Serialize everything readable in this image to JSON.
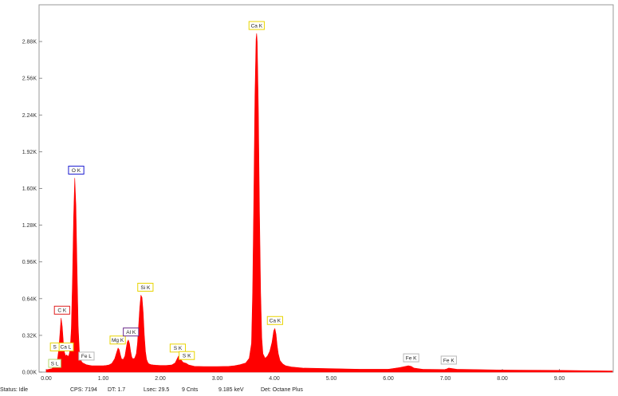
{
  "colors": {
    "spectrum": "#ff0000",
    "label_red": "#e02020",
    "label_blue": "#1c1cd0",
    "label_yellow": "#e8d400",
    "label_purple": "#6a2a8a",
    "label_gray": "#b8b8b8",
    "label_green": "#b8d870"
  },
  "status": {
    "status": "Status: Idle",
    "cps": "CPS: 7194",
    "dt": "DT: 1.7",
    "lsec": "Lsec: 29.5",
    "cnts": "9 Cnts",
    "kev": "9.185 keV",
    "det": "Det: Octane Plus"
  },
  "chart_data": {
    "type": "area",
    "title": "",
    "xlabel": "",
    "ylabel": "",
    "xlim": [
      0,
      10
    ],
    "ylim": [
      0,
      3200
    ],
    "grid": false,
    "legend": "none",
    "x_ticks": [
      0,
      1,
      2,
      3,
      4,
      5,
      6,
      7,
      8,
      9
    ],
    "x_tick_labels": [
      "0.00",
      "1.00",
      "2.00",
      "3.00",
      "4.00",
      "5.00",
      "6.00",
      "7.00",
      "8.00",
      "9.00"
    ],
    "y_ticks": [
      0,
      320,
      640,
      960,
      1280,
      1600,
      1920,
      2240,
      2560,
      2880
    ],
    "y_tick_labels": [
      "0.00K",
      "0.32K",
      "0.64K",
      "0.96K",
      "1.28K",
      "1.60K",
      "1.92K",
      "2.24K",
      "2.56K",
      "2.88K"
    ],
    "series": [
      {
        "x": [
          0.0,
          0.1,
          0.15,
          0.2,
          0.22,
          0.24,
          0.26,
          0.28,
          0.3,
          0.32,
          0.34,
          0.36,
          0.38,
          0.4,
          0.42,
          0.44,
          0.46,
          0.48,
          0.5,
          0.52,
          0.54,
          0.56,
          0.58,
          0.6,
          0.62,
          0.64,
          0.66,
          0.68,
          0.7,
          0.75,
          0.8,
          0.85,
          0.9,
          0.95,
          1.0,
          1.05,
          1.1,
          1.15,
          1.2,
          1.24,
          1.26,
          1.28,
          1.3,
          1.32,
          1.35,
          1.38,
          1.4,
          1.42,
          1.44,
          1.46,
          1.48,
          1.5,
          1.52,
          1.55,
          1.58,
          1.6,
          1.62,
          1.64,
          1.66,
          1.68,
          1.7,
          1.72,
          1.74,
          1.76,
          1.78,
          1.8,
          1.84,
          1.88,
          1.92,
          2.0,
          2.1,
          2.2,
          2.26,
          2.3,
          2.32,
          2.34,
          2.36,
          2.4,
          2.46,
          2.5,
          2.6,
          2.8,
          3.0,
          3.2,
          3.3,
          3.4,
          3.5,
          3.56,
          3.6,
          3.62,
          3.64,
          3.66,
          3.68,
          3.69,
          3.7,
          3.72,
          3.74,
          3.76,
          3.78,
          3.8,
          3.84,
          3.88,
          3.92,
          3.96,
          3.99,
          4.01,
          4.03,
          4.05,
          4.07,
          4.1,
          4.15,
          4.2,
          4.3,
          4.5,
          5.0,
          5.5,
          6.0,
          6.2,
          6.35,
          6.4,
          6.45,
          6.6,
          7.0,
          7.06,
          7.2,
          8.0,
          9.0,
          10.0
        ],
        "y": [
          20,
          30,
          60,
          120,
          200,
          330,
          470,
          400,
          260,
          170,
          140,
          150,
          135,
          150,
          200,
          380,
          800,
          1350,
          1690,
          1450,
          900,
          400,
          190,
          120,
          90,
          80,
          75,
          70,
          65,
          60,
          55,
          55,
          55,
          55,
          55,
          58,
          62,
          75,
          115,
          180,
          210,
          195,
          150,
          115,
          110,
          140,
          200,
          260,
          280,
          250,
          180,
          130,
          115,
          120,
          160,
          250,
          400,
          560,
          670,
          650,
          520,
          320,
          180,
          110,
          85,
          72,
          65,
          62,
          60,
          58,
          58,
          62,
          80,
          120,
          140,
          130,
          110,
          85,
          75,
          62,
          50,
          48,
          48,
          50,
          55,
          65,
          80,
          120,
          250,
          700,
          1500,
          2400,
          2900,
          2950,
          2880,
          2300,
          1400,
          700,
          300,
          160,
          120,
          140,
          180,
          260,
          360,
          380,
          330,
          230,
          160,
          100,
          70,
          55,
          45,
          35,
          30,
          25,
          25,
          40,
          55,
          50,
          35,
          25,
          22,
          35,
          25,
          18,
          15,
          10
        ]
      }
    ],
    "annotations": [
      {
        "text": "C  K",
        "x": 0.277,
        "y": 470,
        "color": "red"
      },
      {
        "text": "O  K",
        "x": 0.525,
        "y": 1690,
        "color": "blue"
      },
      {
        "text": "Ca L",
        "x": 0.341,
        "y": 150,
        "color": "yellow"
      },
      {
        "text": "S L",
        "x": 0.149,
        "y": 90,
        "color": "green"
      },
      {
        "text": "S",
        "x": 0.149,
        "y": 150,
        "color": "yellow"
      },
      {
        "text": "Fe L",
        "x": 0.705,
        "y": 70,
        "color": "gray"
      },
      {
        "text": "Mg K",
        "x": 1.253,
        "y": 210,
        "color": "yellow"
      },
      {
        "text": "Al K",
        "x": 1.486,
        "y": 280,
        "color": "purple"
      },
      {
        "text": "Si K",
        "x": 1.739,
        "y": 670,
        "color": "yellow"
      },
      {
        "text": "S  K",
        "x": 2.307,
        "y": 140,
        "color": "yellow"
      },
      {
        "text": "S  K",
        "x": 2.464,
        "y": 75,
        "color": "yellow"
      },
      {
        "text": "Ca K",
        "x": 3.69,
        "y": 2950,
        "color": "yellow"
      },
      {
        "text": "Ca K",
        "x": 4.012,
        "y": 380,
        "color": "yellow"
      },
      {
        "text": "Fe K",
        "x": 6.4,
        "y": 55,
        "color": "gray"
      },
      {
        "text": "Fe K",
        "x": 7.06,
        "y": 35,
        "color": "gray"
      }
    ]
  }
}
